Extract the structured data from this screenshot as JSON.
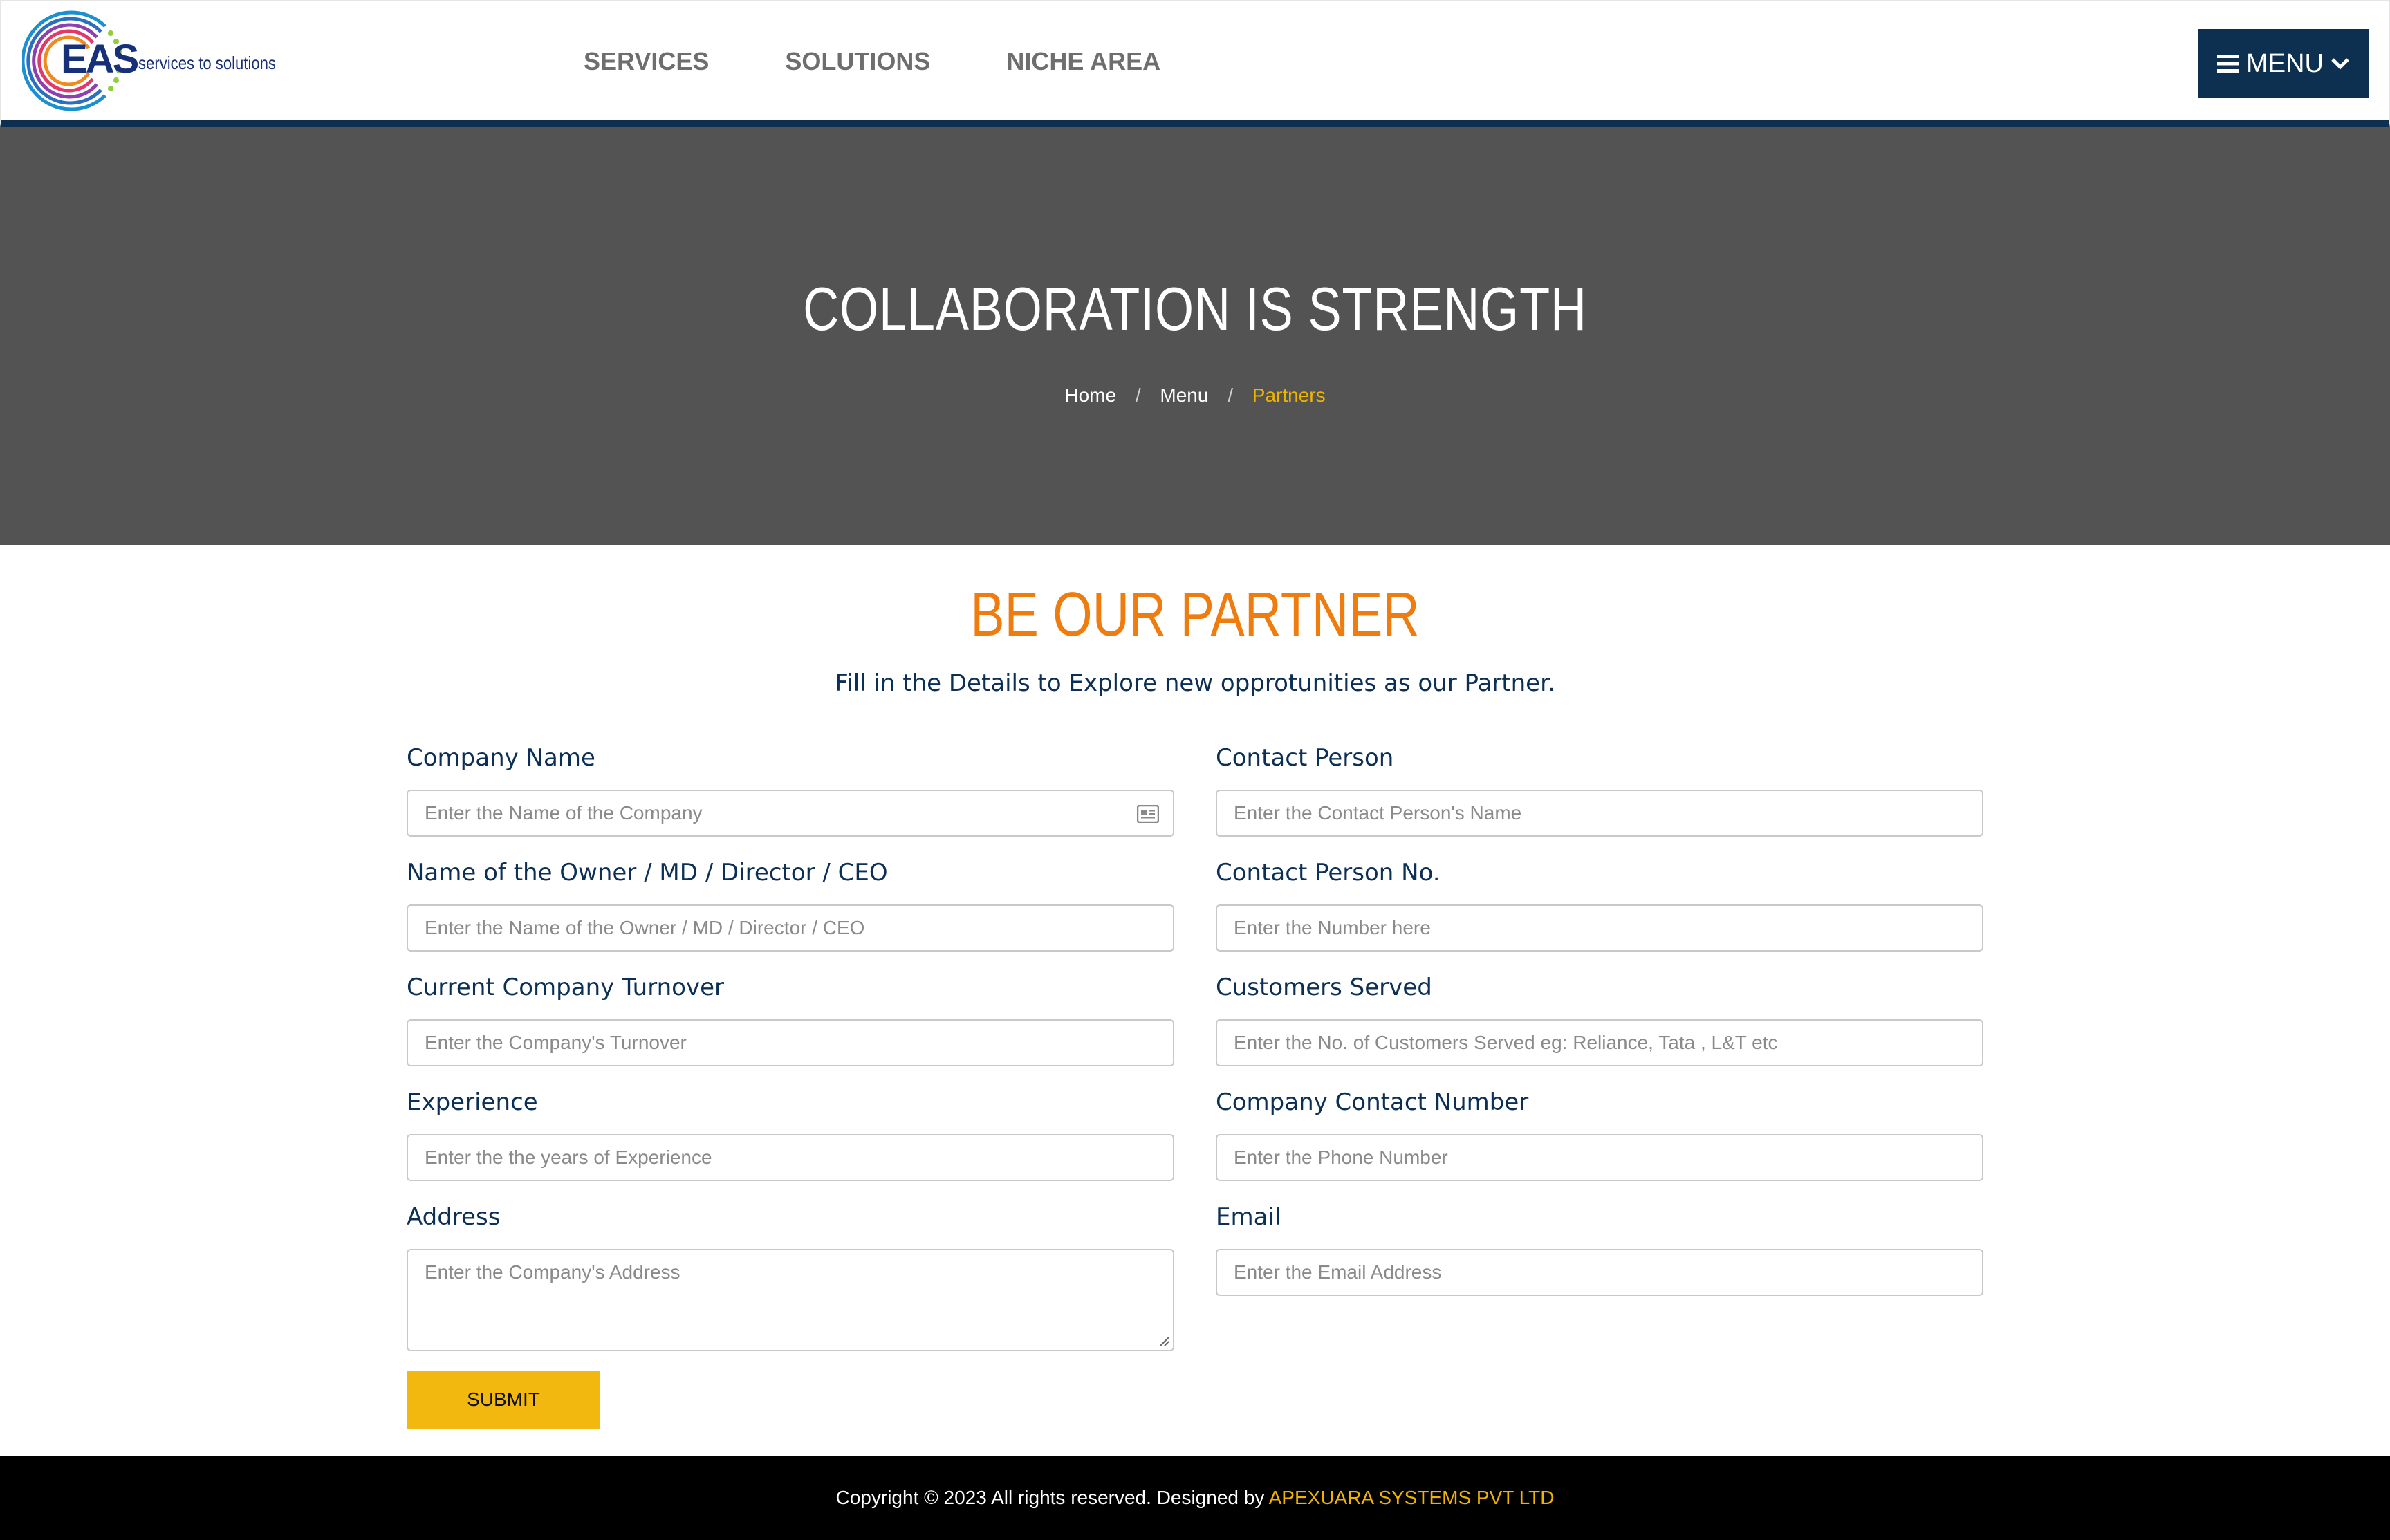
{
  "brand": {
    "logo_text": "EAS",
    "tagline": "services to solutions"
  },
  "nav": {
    "items": [
      {
        "label": "SERVICES"
      },
      {
        "label": "SOLUTIONS"
      },
      {
        "label": "NICHE AREA"
      }
    ],
    "menu_label": "MENU"
  },
  "hero": {
    "title": "COLLABORATION IS STRENGTH",
    "breadcrumb": {
      "home": "Home",
      "menu": "Menu",
      "current": "Partners",
      "separator": "/"
    }
  },
  "partner": {
    "title": "BE OUR PARTNER",
    "subtitle": "Fill in the Details to Explore new opprotunities as our Partner.",
    "fields": {
      "company_name": {
        "label": "Company Name",
        "placeholder": "Enter the Name of the Company"
      },
      "owner_name": {
        "label": "Name of the Owner / MD / Director / CEO",
        "placeholder": "Enter the Name of the Owner / MD / Director / CEO"
      },
      "turnover": {
        "label": "Current Company Turnover",
        "placeholder": "Enter the Company's Turnover"
      },
      "experience": {
        "label": "Experience",
        "placeholder": "Enter the the years of Experience"
      },
      "address": {
        "label": "Address",
        "placeholder": "Enter the Company's Address"
      },
      "contact_person": {
        "label": "Contact Person",
        "placeholder": "Enter the Contact Person's Name"
      },
      "contact_person_no": {
        "label": "Contact Person No.",
        "placeholder": "Enter the Number here"
      },
      "customers_served": {
        "label": "Customers Served",
        "placeholder": "Enter the No. of Customers Served eg: Reliance, Tata , L&T etc"
      },
      "company_contact_number": {
        "label": "Company Contact Number",
        "placeholder": "Enter the Phone Number"
      },
      "email": {
        "label": "Email",
        "placeholder": "Enter the Email Address"
      }
    },
    "submit_label": "SUBMIT"
  },
  "footer": {
    "text": "Copyright © 2023 All rights reserved. Designed by ",
    "link": "APEXUARA SYSTEMS PVT LTD"
  },
  "colors": {
    "navy": "#0d3050",
    "accent_orange": "#ef7c0e",
    "accent_yellow": "#f2b80f",
    "hero_bg": "#535353"
  },
  "icons": {
    "menu": "hamburger-icon",
    "chevron": "chevron-down-icon",
    "field": "contact-card-icon"
  }
}
